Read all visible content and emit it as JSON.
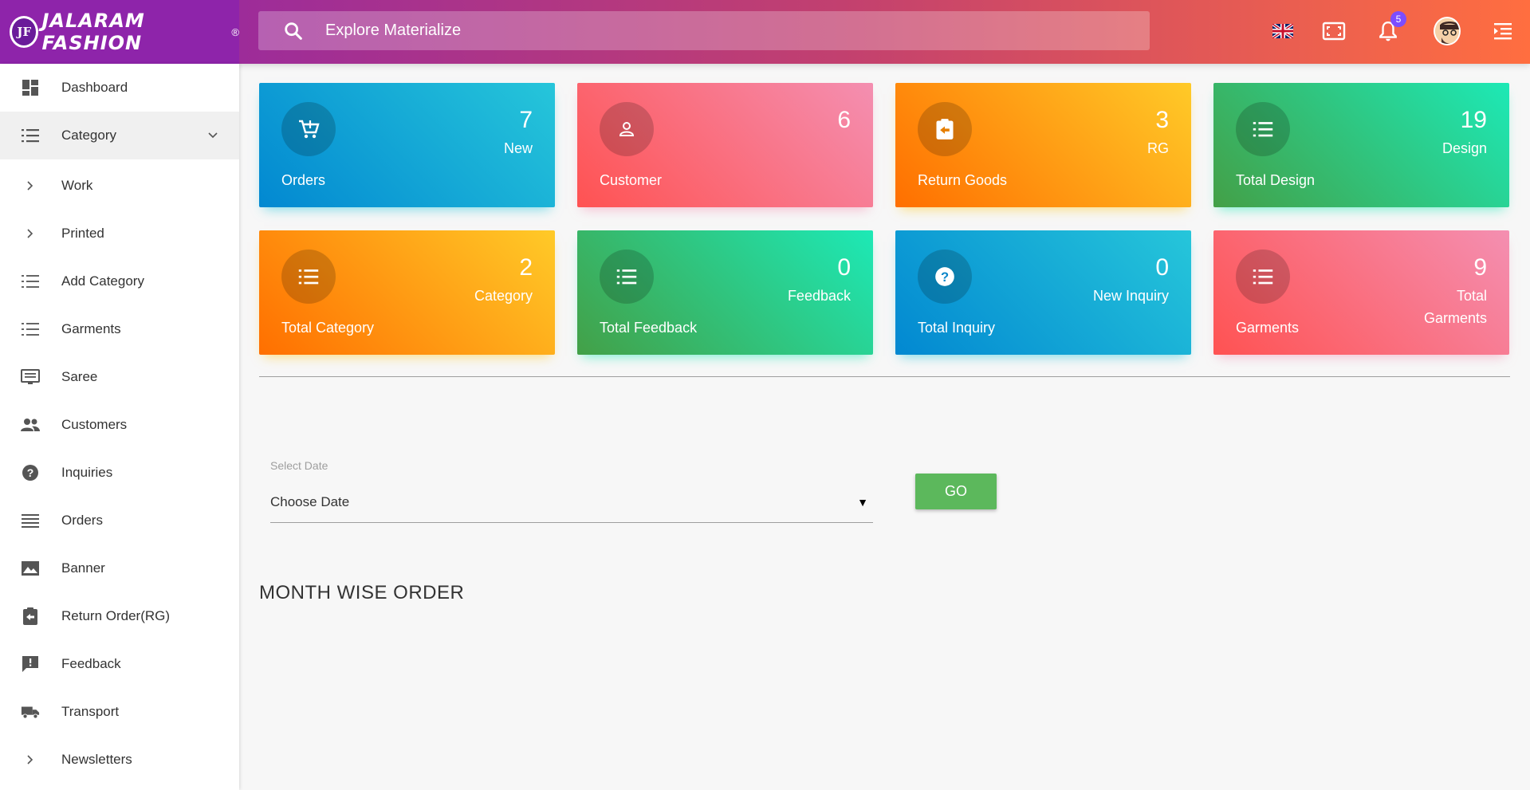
{
  "brand": {
    "badge": "JF",
    "name": "JALARAM FASHION",
    "reg": "®"
  },
  "search": {
    "placeholder": "Explore Materialize"
  },
  "header": {
    "notification_count": "5"
  },
  "sidebar": {
    "items": [
      {
        "label": "Dashboard",
        "icon": "dashboard-icon"
      },
      {
        "label": "Category",
        "icon": "list-icon"
      },
      {
        "label": "Work",
        "icon": "chevron-right-icon"
      },
      {
        "label": "Printed",
        "icon": "chevron-right-icon"
      },
      {
        "label": "Add Category",
        "icon": "list-icon"
      },
      {
        "label": "Garments",
        "icon": "list-icon"
      },
      {
        "label": "Saree",
        "icon": "monitor-icon"
      },
      {
        "label": "Customers",
        "icon": "people-icon"
      },
      {
        "label": "Inquiries",
        "icon": "help-icon"
      },
      {
        "label": "Orders",
        "icon": "lines-icon"
      },
      {
        "label": "Banner",
        "icon": "image-icon"
      },
      {
        "label": "Return Order(RG)",
        "icon": "clipboard-return-icon"
      },
      {
        "label": "Feedback",
        "icon": "feedback-icon"
      },
      {
        "label": "Transport",
        "icon": "truck-icon"
      },
      {
        "label": "Newsletters",
        "icon": "chevron-right-icon"
      }
    ]
  },
  "cards": [
    {
      "number": "7",
      "unit": "New",
      "title": "Orders",
      "icon": "cart-add-icon",
      "color": "#26c6da"
    },
    {
      "number": "6",
      "unit": "",
      "title": "Customer",
      "icon": "person-icon",
      "color": "#ff5252"
    },
    {
      "number": "3",
      "unit": "RG",
      "title": "Return Goods",
      "icon": "clipboard-return-icon",
      "color": "#ff6f00"
    },
    {
      "number": "19",
      "unit": "Design",
      "title": "Total Design",
      "icon": "list-icon",
      "color": "#43a047"
    },
    {
      "number": "2",
      "unit": "Category",
      "title": "Total Category",
      "icon": "list-icon",
      "color": "#ff6f00"
    },
    {
      "number": "0",
      "unit": "Feedback",
      "title": "Total Feedback",
      "icon": "list-icon",
      "color": "#43a047"
    },
    {
      "number": "0",
      "unit": "New Inquiry",
      "title": "Total Inquiry",
      "icon": "help-icon",
      "color": "#0288d1"
    },
    {
      "number": "9",
      "unit": "Total Garments",
      "title": "Garments",
      "icon": "list-icon",
      "color": "#ff5252"
    }
  ],
  "filter": {
    "label": "Select Date",
    "value": "Choose Date",
    "button": "GO"
  },
  "section": {
    "title": "MONTH WISE ORDER"
  }
}
